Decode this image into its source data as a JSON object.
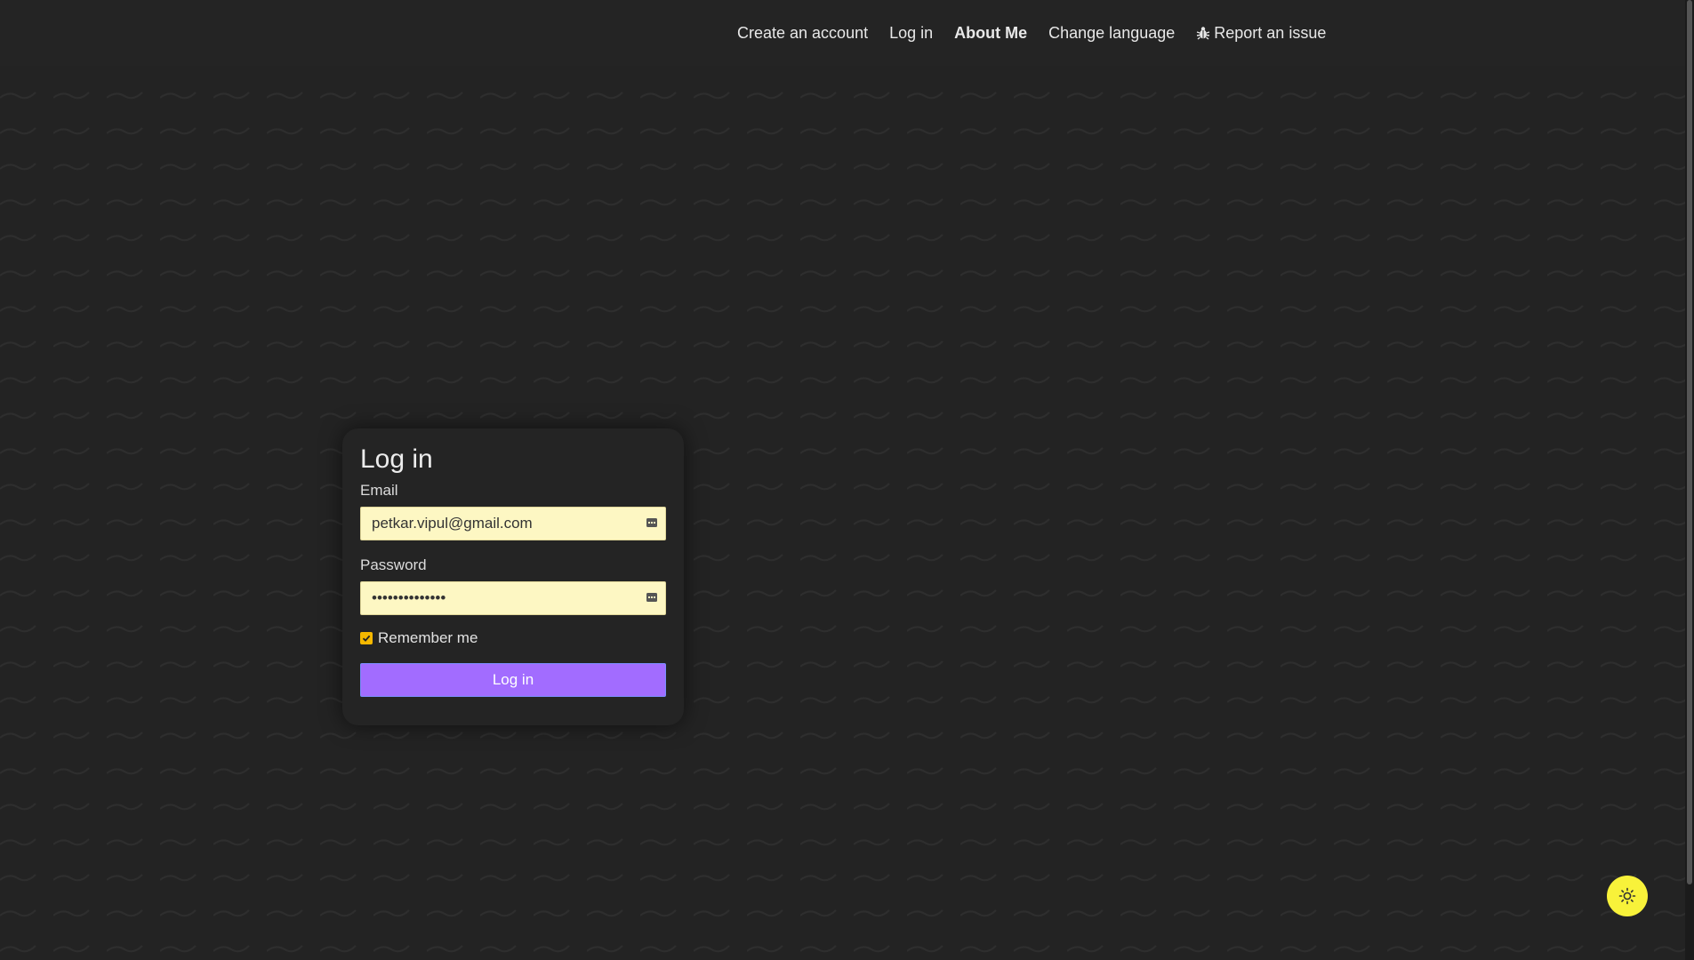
{
  "nav": {
    "create_account": "Create an account",
    "log_in": "Log in",
    "about_me": "About Me",
    "change_language": "Change language",
    "report_issue": "Report an issue"
  },
  "login_form": {
    "title": "Log in",
    "email_label": "Email",
    "email_value": "petkar.vipul@gmail.com",
    "password_label": "Password",
    "password_value": "••••••••••••••",
    "remember_label": "Remember me",
    "remember_checked": true,
    "submit_label": "Log in"
  },
  "theme": {
    "toggle_icon": "sun-icon",
    "accent_color": "#f8f23a",
    "button_color": "#a26cff",
    "input_bg": "#fdf7c3"
  }
}
